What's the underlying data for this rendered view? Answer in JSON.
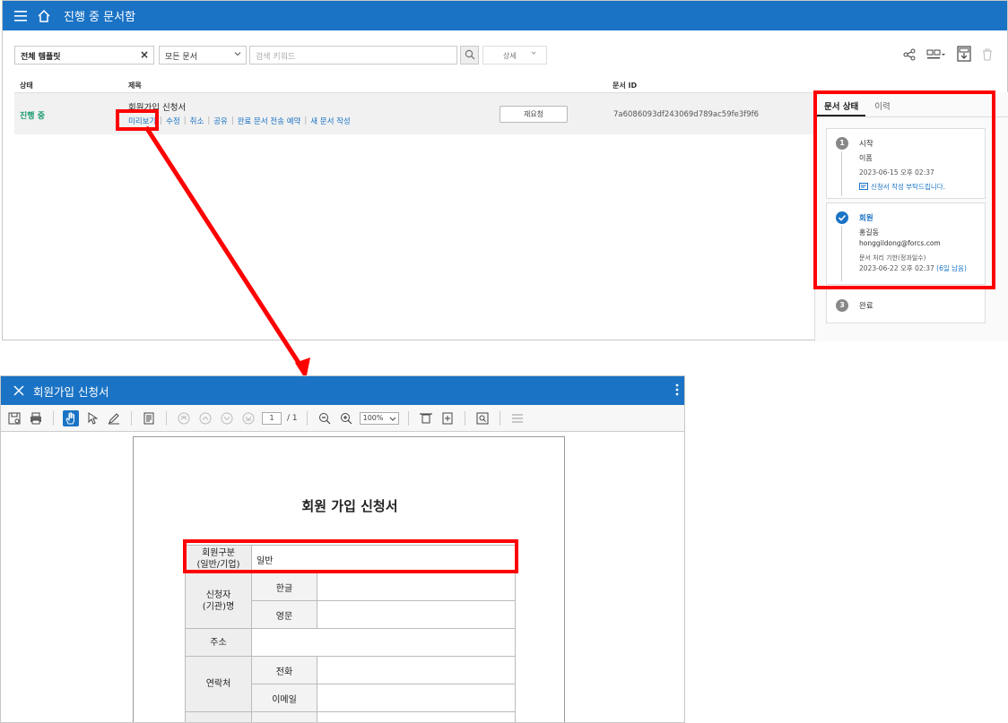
{
  "main_window": {
    "title": "진행 중 문서함",
    "filters": {
      "template": "전체 템플릿",
      "doc_type": "모든 문서",
      "keyword_placeholder": "검색 키워드",
      "detail_label": "상세"
    },
    "table": {
      "headers": {
        "status": "상태",
        "title": "제목",
        "doc_id": "문서 ID"
      },
      "rows": [
        {
          "status": "진행 중",
          "title": "회원가입 신청서",
          "actions": [
            "미리보기",
            "수정",
            "취소",
            "공유",
            "완료 문서 전송 예약",
            "새 문서 작성"
          ],
          "request_button": "재요청",
          "doc_id": "7a6086093df243069d789ac59fe3f9f6"
        }
      ]
    },
    "side_panel": {
      "tabs": [
        "문서 상태",
        "이력"
      ],
      "steps": [
        {
          "number": "1",
          "label": "시작",
          "name": "이폼",
          "time": "2023-06-15 오후 02:37",
          "message": "신청서 작성 부탁드립니다."
        },
        {
          "number": "2",
          "label": "회원",
          "name": "홍길동",
          "email": "honggildong@forcs.com",
          "deadline_label": "문서 처리 기한(정과일수)",
          "deadline_time": "2023-06-22 오후 02:37",
          "deadline_remaining": "(6일 남음)"
        },
        {
          "number": "3",
          "label": "완료"
        }
      ]
    }
  },
  "preview_window": {
    "title": "회원가입 신청서",
    "toolbar": {
      "page_current": "1",
      "page_total": "/ 1",
      "zoom": "100%"
    },
    "document": {
      "heading": "회원 가입 신청서",
      "rows": [
        {
          "label": "회원구분\n(일반/기업)",
          "value": "일반"
        },
        {
          "label": "신청자\n(기관)명",
          "sub": [
            "한글",
            "영문"
          ]
        },
        {
          "label": "주소"
        },
        {
          "label": "연락처",
          "sub": [
            "전화",
            "이메일"
          ]
        }
      ]
    }
  },
  "colors": {
    "brand": "#1a73c5",
    "status_green": "#1a9a6c",
    "callout": "#ff0000"
  }
}
